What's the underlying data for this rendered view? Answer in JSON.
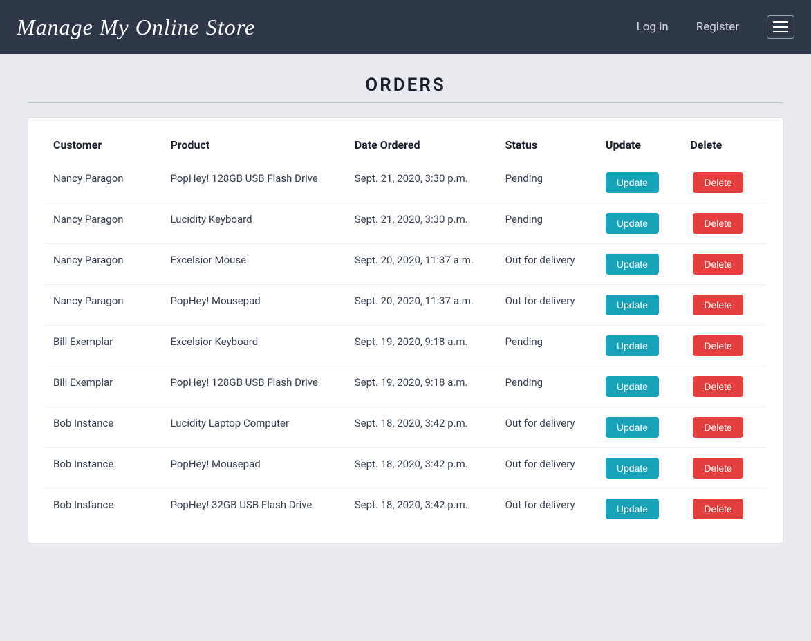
{
  "navbar": {
    "brand": "Manage My Online Store",
    "login_label": "Log in",
    "register_label": "Register"
  },
  "page": {
    "title": "ORDERS"
  },
  "table": {
    "headers": {
      "customer": "Customer",
      "product": "Product",
      "date_ordered": "Date Ordered",
      "status": "Status",
      "update": "Update",
      "delete": "Delete"
    },
    "update_btn": "Update",
    "delete_btn": "Delete",
    "rows": [
      {
        "customer": "Nancy Paragon",
        "product": "PopHey! 128GB USB Flash Drive",
        "date": "Sept. 21, 2020, 3:30 p.m.",
        "status": "Pending"
      },
      {
        "customer": "Nancy Paragon",
        "product": "Lucidity Keyboard",
        "date": "Sept. 21, 2020, 3:30 p.m.",
        "status": "Pending"
      },
      {
        "customer": "Nancy Paragon",
        "product": "Excelsior Mouse",
        "date": "Sept. 20, 2020, 11:37 a.m.",
        "status": "Out for delivery"
      },
      {
        "customer": "Nancy Paragon",
        "product": "PopHey! Mousepad",
        "date": "Sept. 20, 2020, 11:37 a.m.",
        "status": "Out for delivery"
      },
      {
        "customer": "Bill Exemplar",
        "product": "Excelsior Keyboard",
        "date": "Sept. 19, 2020, 9:18 a.m.",
        "status": "Pending"
      },
      {
        "customer": "Bill Exemplar",
        "product": "PopHey! 128GB USB Flash Drive",
        "date": "Sept. 19, 2020, 9:18 a.m.",
        "status": "Pending"
      },
      {
        "customer": "Bob Instance",
        "product": "Lucidity Laptop Computer",
        "date": "Sept. 18, 2020, 3:42 p.m.",
        "status": "Out for delivery"
      },
      {
        "customer": "Bob Instance",
        "product": "PopHey! Mousepad",
        "date": "Sept. 18, 2020, 3:42 p.m.",
        "status": "Out for delivery"
      },
      {
        "customer": "Bob Instance",
        "product": "PopHey! 32GB USB Flash Drive",
        "date": "Sept. 18, 2020, 3:42 p.m.",
        "status": "Out for delivery"
      }
    ]
  }
}
